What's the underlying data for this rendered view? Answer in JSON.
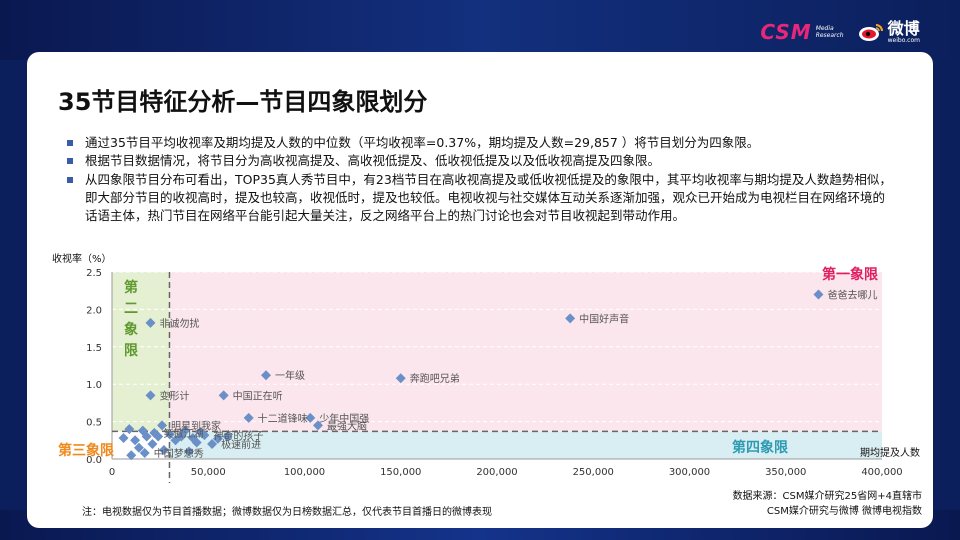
{
  "header": {
    "csm_logo": "CSM",
    "csm_sub_line1": "Media",
    "csm_sub_line2": "Research",
    "weibo_name": "微博",
    "weibo_url": "weibo.com"
  },
  "slide": {
    "title": "35节目特征分析—节目四象限划分",
    "bullets": [
      "通过35节目平均收视率及期均提及人数的中位数（平均收视率=0.37%，期均提及人数=29,857 ）将节目划分为四象限。",
      "根据节目数据情况，将节目分为高收视高提及、高收视低提及、低收视低提及以及低收视高提及四象限。",
      "从四象限节目分布可看出，TOP35真人秀节目中，有23档节目在高收视高提及或低收视低提及的象限中，其平均收视率与期均提及人数趋势相似，即大部分节目的收视高时，提及也较高，收视低时，提及也较低。电视收视与社交媒体互动关系逐渐加强，观众已开始成为电视栏目在网络环境的话语主体，热门节目在网络平台能引起大量关注，反之网络平台上的热门讨论也会对节目收视起到带动作用。"
    ],
    "footnote": "注：电视数据仅为节目首播数据；微博数据仅为日榜数据汇总，仅代表节目首播日的微博表现",
    "source_line1": "数据来源：CSM媒介研究25省网+4直辖市",
    "source_line2": "CSM媒介研究与微博 微博电视指数"
  },
  "colors": {
    "marker": "#6b8fc7",
    "q1_fill": "#fbe6ee",
    "q1_text": "#e01f62",
    "q2_fill": "#e5f0d3",
    "q2_text": "#5e9a2e",
    "q3_text": "#f08a1e",
    "q4_fill": "#d8eef2",
    "q4_text": "#2f9bb3",
    "median_line": "#666666"
  },
  "chart_data": {
    "type": "scatter",
    "xlabel": "期均提及人数",
    "ylabel": "收视率（%）",
    "xlim": [
      0,
      400000
    ],
    "ylim": [
      0,
      2.5
    ],
    "x_ticks": [
      0,
      50000,
      100000,
      150000,
      200000,
      250000,
      300000,
      350000,
      400000
    ],
    "x_tick_labels": [
      "0",
      "50,000",
      "100,000",
      "150,000",
      "200,000",
      "250,000",
      "300,000",
      "350,000",
      "400,000"
    ],
    "y_ticks": [
      0,
      0.5,
      1.0,
      1.5,
      2.0,
      2.5
    ],
    "y_tick_labels": [
      "0.0",
      "0.5",
      "1.0",
      "1.5",
      "2.0",
      "2.5"
    ],
    "median_x": 29857,
    "median_y": 0.37,
    "quadrant_labels": {
      "q1": "第一象限",
      "q2": "第二象限",
      "q3": "第三象限",
      "q4": "第四象限"
    },
    "points": [
      {
        "label": "爸爸去哪儿",
        "x": 367000,
        "y": 2.2
      },
      {
        "label": "中国好声音",
        "x": 238000,
        "y": 1.88
      },
      {
        "label": "非诚勿扰",
        "x": 20000,
        "y": 1.82
      },
      {
        "label": "奔跑吧兄弟",
        "x": 150000,
        "y": 1.08
      },
      {
        "label": "一年级",
        "x": 80000,
        "y": 1.12
      },
      {
        "label": "变形计",
        "x": 20000,
        "y": 0.85
      },
      {
        "label": "中国正在听",
        "x": 58000,
        "y": 0.85
      },
      {
        "label": "十二道锋味",
        "x": 71000,
        "y": 0.55
      },
      {
        "label": "少年中国强",
        "x": 103000,
        "y": 0.55
      },
      {
        "label": "最强大脑",
        "x": 107000,
        "y": 0.45
      },
      {
        "label": "明星到我家",
        "x": 26000,
        "y": 0.45
      },
      {
        "label": "笑傲江湖",
        "x": 22000,
        "y": 0.35
      },
      {
        "label": "神奇的孩子",
        "x": 48000,
        "y": 0.32
      },
      {
        "label": "极速前进",
        "x": 52000,
        "y": 0.2
      },
      {
        "label": "中国梦想秀",
        "x": 17000,
        "y": 0.08
      },
      {
        "label": "",
        "x": 6000,
        "y": 0.28
      },
      {
        "label": "",
        "x": 9000,
        "y": 0.4
      },
      {
        "label": "",
        "x": 12000,
        "y": 0.25
      },
      {
        "label": "",
        "x": 14000,
        "y": 0.15
      },
      {
        "label": "",
        "x": 16000,
        "y": 0.38
      },
      {
        "label": "",
        "x": 18000,
        "y": 0.3
      },
      {
        "label": "",
        "x": 21000,
        "y": 0.2
      },
      {
        "label": "",
        "x": 24000,
        "y": 0.3
      },
      {
        "label": "",
        "x": 27000,
        "y": 0.12
      },
      {
        "label": "",
        "x": 30000,
        "y": 0.33
      },
      {
        "label": "",
        "x": 33000,
        "y": 0.25
      },
      {
        "label": "",
        "x": 36000,
        "y": 0.3
      },
      {
        "label": "",
        "x": 38000,
        "y": 0.38
      },
      {
        "label": "",
        "x": 40000,
        "y": 0.1
      },
      {
        "label": "",
        "x": 42000,
        "y": 0.28
      },
      {
        "label": "",
        "x": 44000,
        "y": 0.22
      },
      {
        "label": "",
        "x": 46000,
        "y": 0.36
      },
      {
        "label": "",
        "x": 55000,
        "y": 0.27
      },
      {
        "label": "",
        "x": 60000,
        "y": 0.3
      },
      {
        "label": "",
        "x": 10000,
        "y": 0.05
      }
    ]
  }
}
